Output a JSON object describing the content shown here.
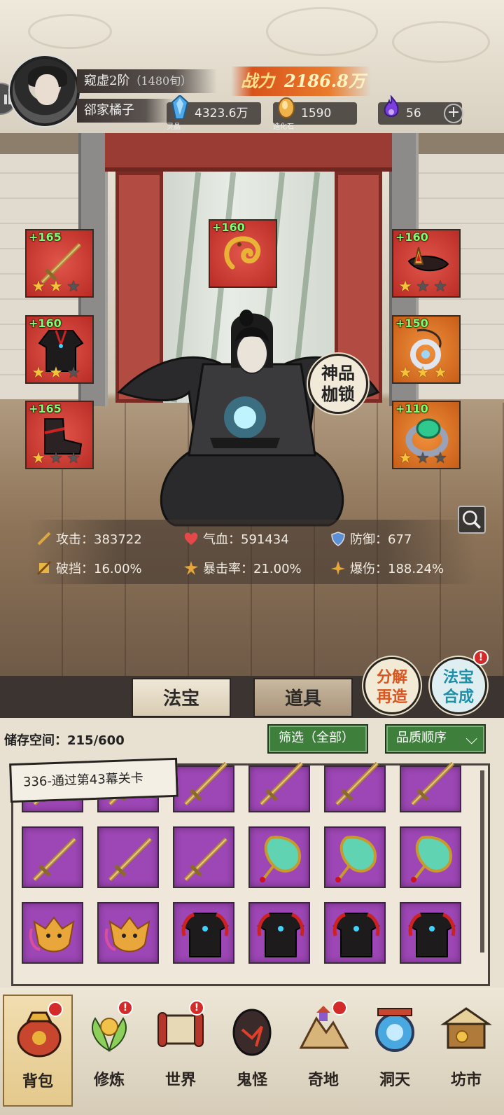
{
  "header": {
    "realm": "窥虚2阶",
    "lifespan": "（1480旬）",
    "player_name": "郤家橘子",
    "power_label": "战力",
    "power_value": "2186.8万",
    "resources": [
      {
        "name": "lingjing",
        "caption": "灵晶",
        "value": "4323.6万"
      },
      {
        "name": "zaohua",
        "caption": "造化石",
        "value": "1590"
      },
      {
        "name": "flame",
        "caption": "",
        "value": "56"
      }
    ],
    "plus": "+"
  },
  "equipment": {
    "left": [
      {
        "level": "+165",
        "stars_on": 2,
        "rarity": "red",
        "item": "sword"
      },
      {
        "level": "+160",
        "stars_on": 2,
        "rarity": "red",
        "item": "robe"
      },
      {
        "level": "+165",
        "stars_on": 1,
        "rarity": "red",
        "item": "boots"
      }
    ],
    "center": {
      "level": "+160",
      "rarity": "red",
      "item": "dragon"
    },
    "right": [
      {
        "level": "+160",
        "stars_on": 1,
        "rarity": "red",
        "item": "crown"
      },
      {
        "level": "+150",
        "stars_on": 3,
        "rarity": "orange",
        "item": "pendant"
      },
      {
        "level": "+110",
        "stars_on": 1,
        "rarity": "orange",
        "item": "ring"
      }
    ],
    "shackle_line1": "神品",
    "shackle_line2": "枷锁"
  },
  "stats": {
    "attack": "攻击：383722",
    "hp": "气血：591434",
    "defense": "防御：677",
    "pierce": "破挡：16.00%",
    "crit_rate": "暴击率：21.00%",
    "crit_dmg": "爆伤：188.24%"
  },
  "tabs": {
    "fabao": "法宝",
    "daoju": "道具",
    "decompose_1": "分解",
    "decompose_2": "再造",
    "synth_1": "法宝",
    "synth_2": "合成",
    "badge": "!"
  },
  "inventory": {
    "storage": "储存空间：215/600",
    "filter": "筛选（全部）",
    "sort": "品质顺序",
    "quest_tip": "336-通过第43幕关卡",
    "rows": [
      [
        "sword",
        "sword",
        "sword",
        "sword",
        "sword",
        "sword"
      ],
      [
        "sword",
        "sword",
        "sword",
        "fan",
        "fan",
        "fan"
      ],
      [
        "fox",
        "fox",
        "robe",
        "robe",
        "robe",
        "robe"
      ]
    ]
  },
  "nav": [
    {
      "label": "背包",
      "icon": "bag-icon",
      "badge": "dot",
      "active": true
    },
    {
      "label": "修炼",
      "icon": "lotus-icon",
      "badge": "!"
    },
    {
      "label": "世界",
      "icon": "scroll-icon",
      "badge": "!"
    },
    {
      "label": "鬼怪",
      "icon": "demon-egg-icon",
      "badge": ""
    },
    {
      "label": "奇地",
      "icon": "mountain-icon",
      "badge": "dot"
    },
    {
      "label": "洞天",
      "icon": "portal-icon",
      "badge": ""
    },
    {
      "label": "坊市",
      "icon": "market-icon",
      "badge": ""
    }
  ],
  "colors": {
    "slot_red": "#c93a32",
    "slot_orange": "#e07a2a",
    "cell_purple": "#9d46b5",
    "level_green": "#7cff6c",
    "power_orange": "#ea7b2c"
  }
}
